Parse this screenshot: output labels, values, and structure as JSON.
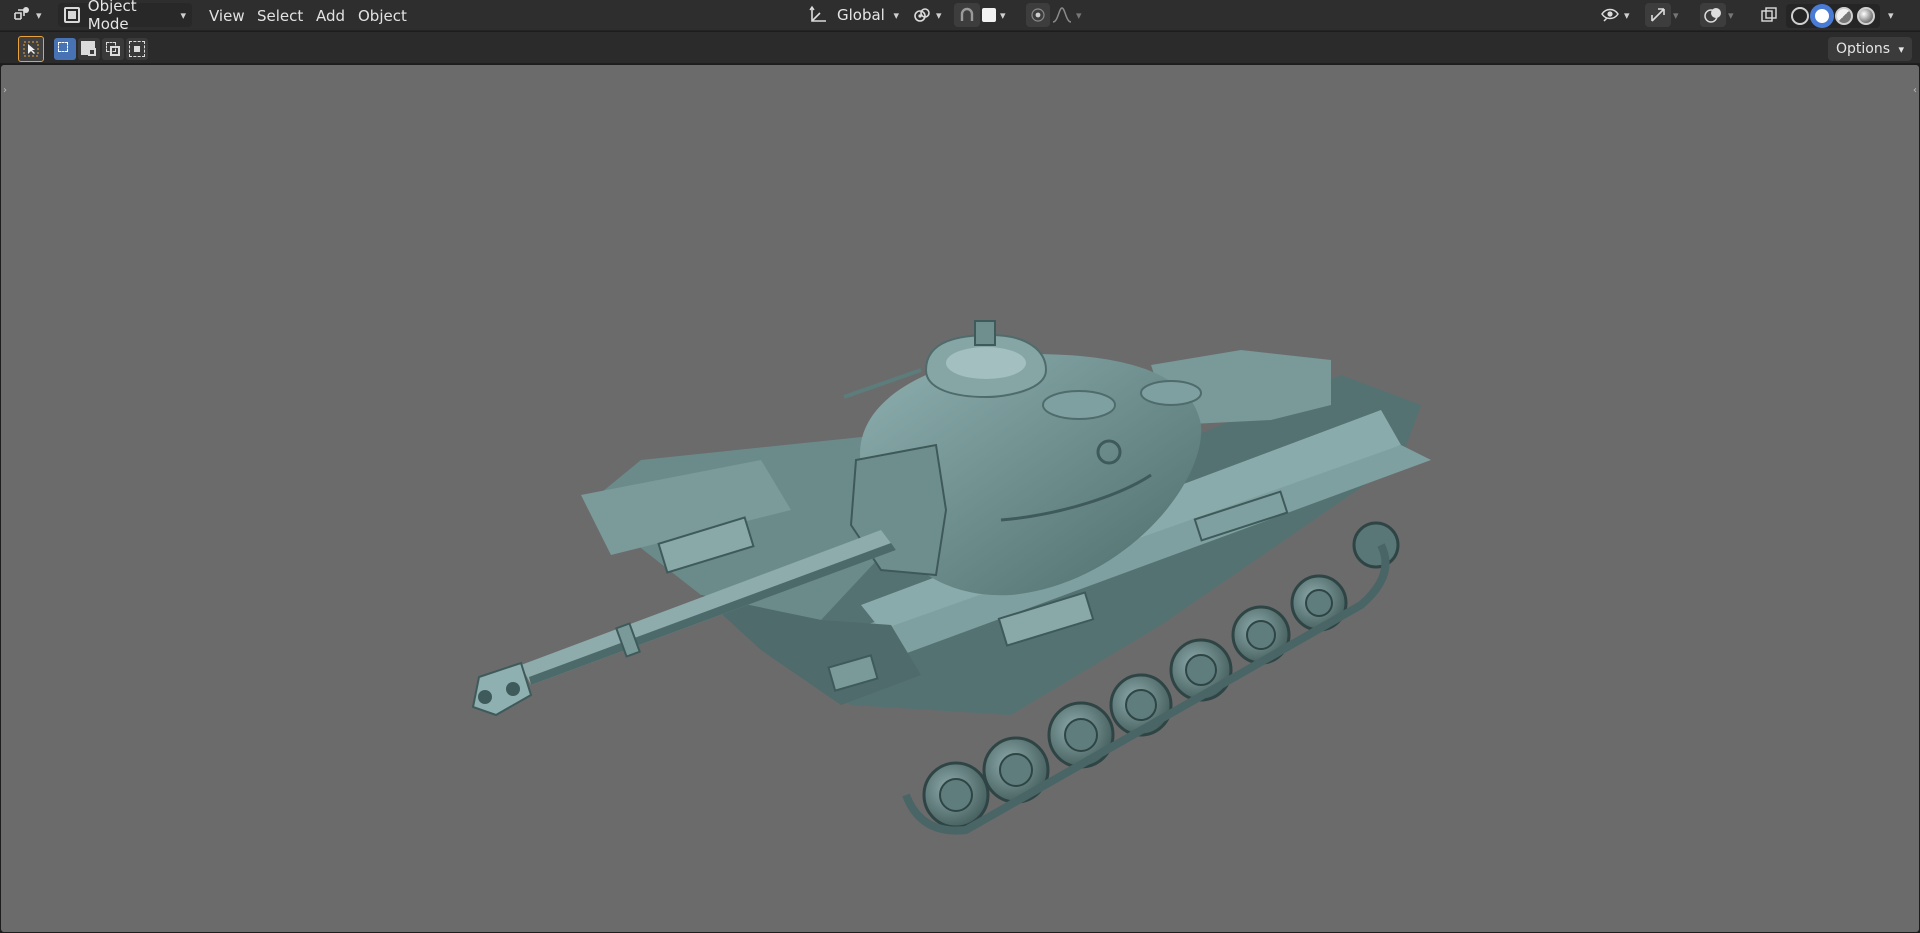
{
  "header": {
    "editor_icon": "editor-type-icon",
    "mode": {
      "label": "Object Mode",
      "icon": "object-mode-icon"
    },
    "menus": [
      "View",
      "Select",
      "Add",
      "Object"
    ],
    "transform_orientation": {
      "label": "Global",
      "icon": "transform-orientation-icon"
    },
    "pivot_icon": "pivot-point-icon",
    "snap_icon": "snap-icon",
    "proportional_icon": "proportional-editing-icon",
    "falloff_icon": "falloff-curve-icon",
    "visibility_icon": "object-visibility-icon",
    "gizmo_icon": "gizmo-icon",
    "overlay_icon": "overlay-icon",
    "xray_icon": "xray-icon",
    "shading_modes": [
      "wireframe",
      "solid",
      "material-preview",
      "rendered"
    ],
    "active_shading": "solid"
  },
  "toolbar": {
    "select_tool_icon": "select-box-tool-icon",
    "selection_modes": [
      "set-new",
      "extend",
      "subtract",
      "intersect"
    ],
    "options_label": "Options"
  },
  "viewport": {
    "background": "#6b6b6b",
    "model_color": "#6f9292",
    "object": "tank-model"
  }
}
